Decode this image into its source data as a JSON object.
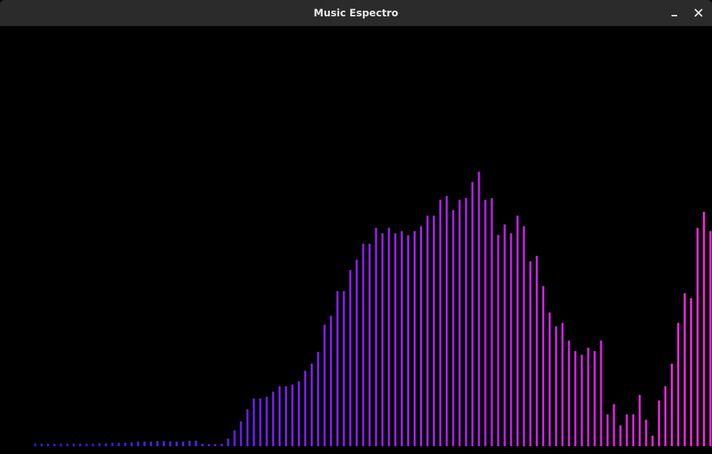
{
  "window": {
    "title": "Music Espectro"
  },
  "controls": {
    "minimize_icon": "minimize-icon",
    "close_icon": "close-icon"
  },
  "colors": {
    "background": "#000000",
    "titlebar": "#2b2b2b",
    "bar_start": "#2a1aff",
    "bar_end": "#ff22dd"
  },
  "chart_data": {
    "type": "bar",
    "ylim": [
      0,
      100
    ],
    "values": [
      0.6,
      0.6,
      0.6,
      0.6,
      0.6,
      0.6,
      0.6,
      0.6,
      0.6,
      0.6,
      0.7,
      0.7,
      0.8,
      0.8,
      0.8,
      0.9,
      1.1,
      1.1,
      1.1,
      1.2,
      1.2,
      1.1,
      1.1,
      1.1,
      1.3,
      1.3,
      0.6,
      0.5,
      0.5,
      0.6,
      1.8,
      3.8,
      5.9,
      8.8,
      11.4,
      11.4,
      11.8,
      13.0,
      14.3,
      14.3,
      14.7,
      15.5,
      18.0,
      19.7,
      22.5,
      29.0,
      31.1,
      37.0,
      37.0,
      42.0,
      44.5,
      48.3,
      48.3,
      52.1,
      50.8,
      52.1,
      50.8,
      51.3,
      50.3,
      51.3,
      52.5,
      55.0,
      55.0,
      58.8,
      59.7,
      56.3,
      58.8,
      59.2,
      63.0,
      65.5,
      58.8,
      59.2,
      50.4,
      52.9,
      50.8,
      55.0,
      52.5,
      44.1,
      45.4,
      38.2,
      31.9,
      28.6,
      29.4,
      25.2,
      22.7,
      21.8,
      23.5,
      22.7,
      25.2,
      7.6,
      10.0,
      5.0,
      7.6,
      7.6,
      12.2,
      6.3,
      2.5,
      10.9,
      14.3,
      19.7,
      29.4,
      36.5,
      35.3,
      52.1,
      55.9,
      51.3,
      51.3
    ]
  }
}
